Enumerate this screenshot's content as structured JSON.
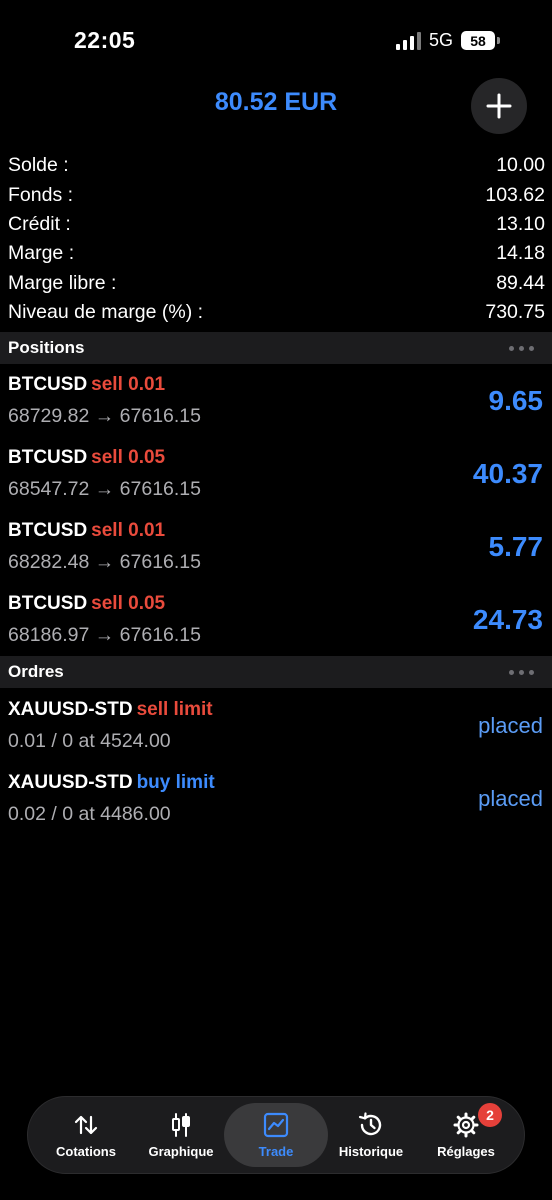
{
  "status_bar": {
    "time": "22:05",
    "network": "5G",
    "battery": "58"
  },
  "header": {
    "balance": "80.52 EUR",
    "add_icon": "plus-icon"
  },
  "account": [
    {
      "label": "Solde :",
      "value": "10.00"
    },
    {
      "label": "Fonds :",
      "value": "103.62"
    },
    {
      "label": "Crédit :",
      "value": "13.10"
    },
    {
      "label": "Marge :",
      "value": "14.18"
    },
    {
      "label": "Marge libre :",
      "value": "89.44"
    },
    {
      "label": "Niveau de marge (%) :",
      "value": "730.75"
    }
  ],
  "positions": {
    "title": "Positions",
    "items": [
      {
        "symbol": "BTCUSD",
        "side": "sell 0.01",
        "prices": "68729.82 → 67616.15",
        "profit": "9.65"
      },
      {
        "symbol": "BTCUSD",
        "side": "sell 0.05",
        "prices": "68547.72 → 67616.15",
        "profit": "40.37"
      },
      {
        "symbol": "BTCUSD",
        "side": "sell 0.01",
        "prices": "68282.48 → 67616.15",
        "profit": "5.77"
      },
      {
        "symbol": "BTCUSD",
        "side": "sell 0.05",
        "prices": "68186.97 → 67616.15",
        "profit": "24.73"
      }
    ]
  },
  "orders": {
    "title": "Ordres",
    "items": [
      {
        "symbol": "XAUUSD-STD",
        "type": "sell limit",
        "details": "0.01 / 0 at 4524.00",
        "status": "placed"
      },
      {
        "symbol": "XAUUSD-STD",
        "type": "buy limit",
        "details": "0.02 / 0 at 4486.00",
        "status": "placed"
      }
    ]
  },
  "tabs": [
    {
      "label": "Cotations",
      "icon": "sort-arrows-icon"
    },
    {
      "label": "Graphique",
      "icon": "candlestick-icon"
    },
    {
      "label": "Trade",
      "icon": "trade-chart-icon",
      "active": true
    },
    {
      "label": "Historique",
      "icon": "history-clock-icon"
    },
    {
      "label": "Réglages",
      "icon": "gear-icon",
      "badge": "2"
    }
  ],
  "colors": {
    "accent": "#3d8bfd",
    "sell": "#e94b3c",
    "background": "#000000",
    "section_bg": "#1c1c1e",
    "badge": "#e5403a"
  }
}
